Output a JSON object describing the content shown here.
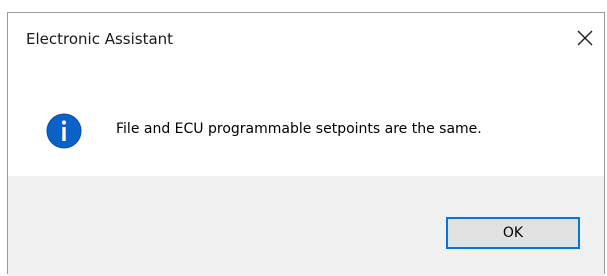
{
  "dialog": {
    "title": "Electronic Assistant",
    "message": "File and ECU programmable setpoints are the same.",
    "icon": "info-icon",
    "ok_label": "OK"
  },
  "colors": {
    "accent": "#0078d7",
    "footer_bg": "#f0f0f0",
    "button_bg": "#e1e1e1"
  }
}
